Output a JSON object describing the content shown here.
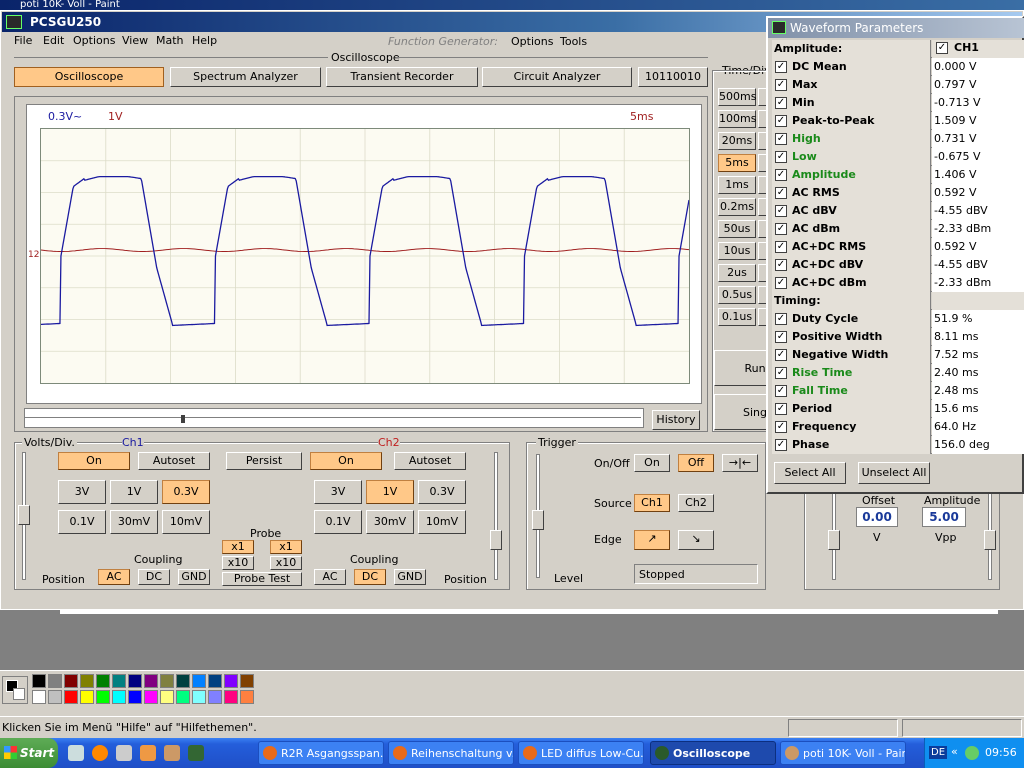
{
  "paint": {
    "title": "poti 10K- Voll - Paint",
    "status": "Klicken Sie im Menü \"Hilfe\" auf \"Hilfethemen\".",
    "palette": [
      "#000000",
      "#808080",
      "#800000",
      "#808000",
      "#008000",
      "#008080",
      "#000080",
      "#800080",
      "#808040",
      "#004040",
      "#0080ff",
      "#004080",
      "#8000ff",
      "#804000",
      "#ffffff",
      "#c0c0c0",
      "#ff0000",
      "#ffff00",
      "#00ff00",
      "#00ffff",
      "#0000ff",
      "#ff00ff",
      "#ffff80",
      "#00ff80",
      "#80ffff",
      "#8080ff",
      "#ff0080",
      "#ff8040"
    ]
  },
  "taskbar": {
    "start": "Start",
    "tasks": [
      {
        "label": "R2R Asgangsspan...",
        "active": false
      },
      {
        "label": "Reihenschaltung v...",
        "active": false
      },
      {
        "label": "LED diffus Low-Cu...",
        "active": false
      },
      {
        "label": "Oscilloscope",
        "active": true
      },
      {
        "label": "poti 10K- Voll - Paint",
        "active": false
      }
    ],
    "lang": "DE",
    "clock": "09:56"
  },
  "app": {
    "title": "PCSGU250",
    "menu": [
      "File",
      "Edit",
      "Options",
      "View",
      "Math",
      "Help"
    ],
    "section_oscilloscope": "Oscilloscope",
    "section_function_generator": "Function Generator:",
    "fg_menu": [
      "Options",
      "Tools"
    ],
    "tabs": [
      "Oscilloscope",
      "Spectrum Analyzer",
      "Transient Recorder",
      "Circuit Analyzer",
      "10110010"
    ],
    "active_tab": "Oscilloscope"
  },
  "scope": {
    "ch1_scale": "0.3V~",
    "ch2_scale": "1V",
    "time_scale": "5ms",
    "ch_marker": "12",
    "history": "History",
    "ch1_color": "#1a1aa0",
    "ch2_color": "#a02020"
  },
  "timediv": {
    "title": "Time/Div",
    "buttons": [
      "500ms",
      "100ms",
      "20ms",
      "5ms",
      "1ms",
      "0.2ms",
      "50us",
      "10us",
      "2us",
      "0.5us",
      "0.1us"
    ],
    "active": "5ms",
    "run": "Run",
    "single": "Single"
  },
  "volts": {
    "title": "Volts/Div.",
    "ch1": "Ch1",
    "ch2": "Ch2",
    "on": "On",
    "autoset": "Autoset",
    "persist": "Persist",
    "ranges_top": [
      "3V",
      "1V",
      "0.3V"
    ],
    "ranges_bottom": [
      "0.1V",
      "30mV",
      "10mV"
    ],
    "ch1_active": "0.3V",
    "ch2_active": "1V",
    "probe": "Probe",
    "probe_x1": "x1",
    "probe_x10": "x10",
    "probe_test": "Probe Test",
    "coupling": "Coupling",
    "coupling_opts": [
      "AC",
      "DC",
      "GND"
    ],
    "ch1_coupling": "AC",
    "ch2_coupling": "DC",
    "position": "Position"
  },
  "trigger": {
    "title": "Trigger",
    "onoff_label": "On/Off",
    "on": "On",
    "off": "Off",
    "source_label": "Source",
    "source_ch1": "Ch1",
    "source_ch2": "Ch2",
    "edge_label": "Edge",
    "level": "Level",
    "status": "Stopped"
  },
  "generator": {
    "offset_label": "Offset",
    "offset_value": "0.00",
    "offset_unit": "V",
    "amplitude_label": "Amplitude",
    "amplitude_value": "5.00",
    "amplitude_unit": "Vpp"
  },
  "params": {
    "title": "Waveform Parameters",
    "amplitude_header": "Amplitude:",
    "ch_header": "CH1",
    "timing_header": "Timing:",
    "rows": [
      {
        "name": "DC  Mean",
        "value": "0.000 V",
        "green": false
      },
      {
        "name": "Max",
        "value": "0.797 V",
        "green": false
      },
      {
        "name": "Min",
        "value": "-0.713 V",
        "green": false
      },
      {
        "name": "Peak-to-Peak",
        "value": "1.509 V",
        "green": false
      },
      {
        "name": "High",
        "value": "0.731 V",
        "green": true
      },
      {
        "name": "Low",
        "value": "-0.675 V",
        "green": true
      },
      {
        "name": "Amplitude",
        "value": "1.406 V",
        "green": true
      },
      {
        "name": "AC RMS",
        "value": "0.592 V",
        "green": false
      },
      {
        "name": "AC dBV",
        "value": "-4.55 dBV",
        "green": false
      },
      {
        "name": "AC dBm",
        "value": "-2.33 dBm",
        "green": false
      },
      {
        "name": "AC+DC RMS",
        "value": "0.592 V",
        "green": false
      },
      {
        "name": "AC+DC dBV",
        "value": "-4.55 dBV",
        "green": false
      },
      {
        "name": "AC+DC dBm",
        "value": "-2.33 dBm",
        "green": false
      }
    ],
    "timing_rows": [
      {
        "name": "Duty Cycle",
        "value": "51.9 %",
        "green": false
      },
      {
        "name": "Positive Width",
        "value": "8.11 ms",
        "green": false
      },
      {
        "name": "Negative Width",
        "value": "7.52 ms",
        "green": false
      },
      {
        "name": "Rise Time",
        "value": "2.40 ms",
        "green": true
      },
      {
        "name": "Fall Time",
        "value": "2.48 ms",
        "green": true
      },
      {
        "name": "Period",
        "value": "15.6 ms",
        "green": false
      },
      {
        "name": "Frequency",
        "value": "64.0 Hz",
        "green": false
      },
      {
        "name": "Phase",
        "value": "156.0 deg",
        "green": false
      }
    ],
    "select_all": "Select All",
    "unselect_all": "Unselect All"
  }
}
